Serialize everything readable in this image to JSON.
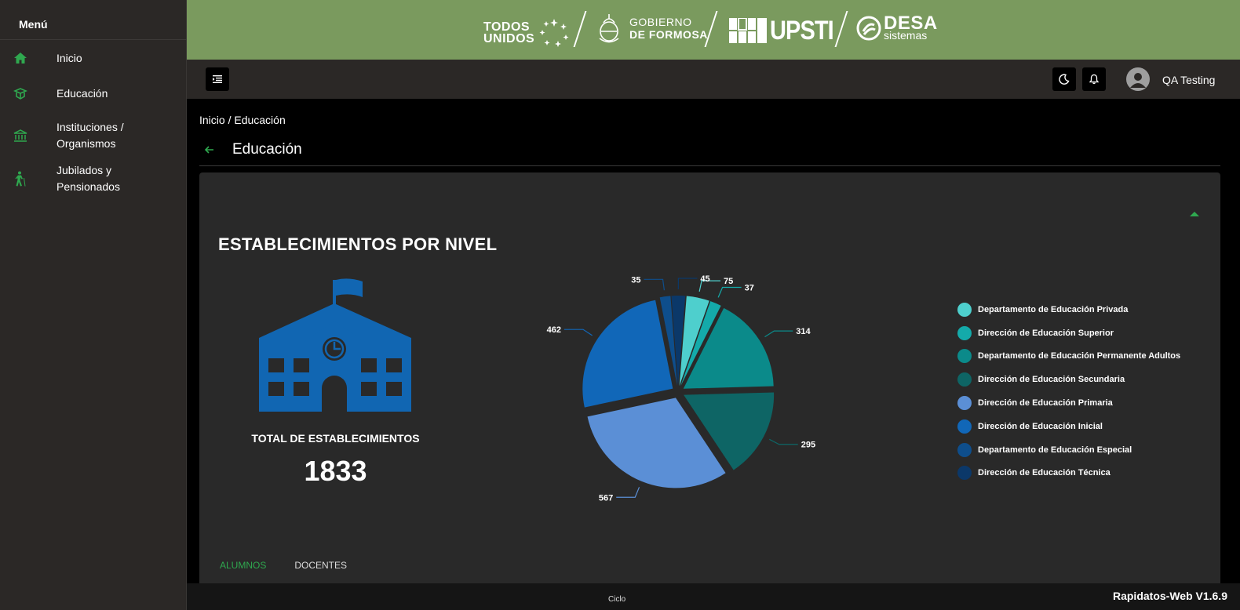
{
  "sidebar": {
    "title": "Menú",
    "items": [
      {
        "label": "Inicio",
        "icon": "home-icon"
      },
      {
        "label": "Educación",
        "icon": "book-icon"
      },
      {
        "label": "Instituciones / Organismos",
        "icon": "institution-icon"
      },
      {
        "label": "Jubilados y Pensionados",
        "icon": "elderly-icon"
      }
    ]
  },
  "banner": {
    "logo_todos_line1": "TODOS",
    "logo_todos_line2": "UNIDOS",
    "logo_gob_line1": "GOBIERNO",
    "logo_gob_line2": "DE FORMOSA",
    "logo_upsti": "UPSTI",
    "logo_desa_line1": "DESA",
    "logo_desa_line2": "sistemas"
  },
  "topbar": {
    "user_name": "QA Testing"
  },
  "breadcrumb": "Inicio / Educación",
  "page_title": "Educación",
  "card": {
    "title": "ESTABLECIMIENTOS POR NIVEL",
    "total_label": "TOTAL DE ESTABLECIMIENTOS",
    "total_value": "1833"
  },
  "chart_data": {
    "type": "pie",
    "categories": [
      "Departamento de Educación Privada",
      "Dirección de Educación Superior",
      "Departamento de Educación Permanente Adultos",
      "Dirección de Educación Secundaria",
      "Dirección de Educación Primaria",
      "Dirección de Educación Inicial",
      "Departamento de Educación Especial",
      "Dirección de Educación Técnica"
    ],
    "values": [
      75,
      37,
      314,
      295,
      567,
      462,
      35,
      45
    ],
    "colors": [
      "#4ecfcd",
      "#14aaaa",
      "#0b8a8a",
      "#0e6565",
      "#5b8fd6",
      "#1167b8",
      "#0e4e8c",
      "#0b3869"
    ],
    "legend_position": "right"
  },
  "tabs": [
    {
      "label": "ALUMNOS",
      "active": true
    },
    {
      "label": "DOCENTES",
      "active": false
    }
  ],
  "footer": {
    "ciclo_label": "Ciclo",
    "version": "Rapidatos-Web V1.6.9"
  },
  "colors": {
    "accent": "#2fa84f",
    "banner": "#7a9a5e",
    "sidebar": "#2b2826",
    "card": "#292929"
  }
}
